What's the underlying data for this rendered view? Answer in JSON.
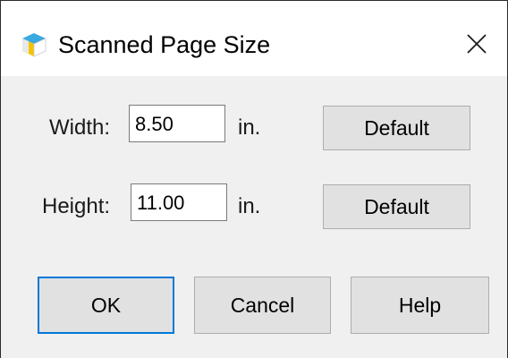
{
  "window": {
    "title": "Scanned Page Size",
    "app_icon": "scanner-app-icon",
    "close_icon": "close-icon"
  },
  "fields": [
    {
      "label": "Width:",
      "value": "8.50",
      "unit": "in.",
      "default_label": "Default"
    },
    {
      "label": "Height:",
      "value": "11.00",
      "unit": "in.",
      "default_label": "Default"
    }
  ],
  "buttons": {
    "ok": "OK",
    "cancel": "Cancel",
    "help": "Help"
  },
  "colors": {
    "focus_border": "#0078d7",
    "button_face": "#e1e1e1",
    "dialog_background": "#f0f0f0"
  }
}
